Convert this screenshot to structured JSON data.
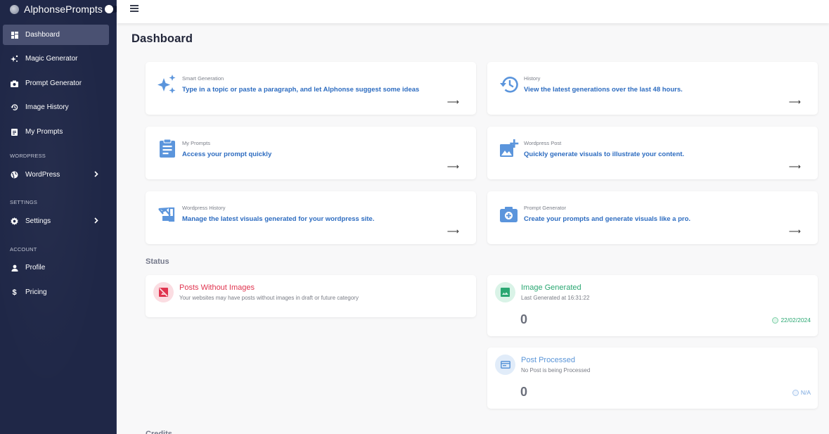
{
  "brand": {
    "name": "AlphonsePrompts"
  },
  "sidebar": {
    "items": [
      {
        "label": "Dashboard",
        "icon": "dashboard-icon",
        "active": true
      },
      {
        "label": "Magic Generator",
        "icon": "sparkles-icon"
      },
      {
        "label": "Prompt Generator",
        "icon": "camera-icon"
      },
      {
        "label": "Image History",
        "icon": "history-icon"
      },
      {
        "label": "My Prompts",
        "icon": "clipboard-icon"
      }
    ],
    "sections": [
      {
        "label": "WORDPRESS",
        "items": [
          {
            "label": "WordPress",
            "icon": "globe-icon",
            "has_submenu": true
          }
        ]
      },
      {
        "label": "SETTINGS",
        "items": [
          {
            "label": "Settings",
            "icon": "gear-icon",
            "has_submenu": true
          }
        ]
      },
      {
        "label": "ACCOUNT",
        "items": [
          {
            "label": "Profile",
            "icon": "user-icon"
          },
          {
            "label": "Pricing",
            "icon": "dollar-icon"
          }
        ]
      }
    ]
  },
  "page": {
    "title": "Dashboard"
  },
  "features": [
    {
      "label": "Smart Generation",
      "description": "Type in a topic or paste a paragraph, and let Alphonse suggest some ideas",
      "icon": "sparkles-icon",
      "arrow": "⟶"
    },
    {
      "label": "History",
      "description": "View the latest generations over the last 48 hours.",
      "icon": "history-icon",
      "arrow": "⟶"
    },
    {
      "label": "My Prompts",
      "description": "Access your prompt quickly",
      "icon": "clipboard-icon",
      "arrow": "⟶"
    },
    {
      "label": "Wordpress Post",
      "description": "Quickly generate visuals to illustrate your content.",
      "icon": "add-image-icon",
      "arrow": "⟶"
    },
    {
      "label": "Wordpress History",
      "description": "Manage the latest visuals generated for your wordpress site.",
      "icon": "image-history-icon",
      "arrow": "⟶"
    },
    {
      "label": "Prompt Generator",
      "description": "Create your prompts and generate visuals like a pro.",
      "icon": "camera-plus-icon",
      "arrow": "⟶"
    }
  ],
  "status": {
    "title": "Status",
    "posts_without_images": {
      "title": "Posts Without Images",
      "subtitle": "Your websites may have posts without images in draft or future category",
      "color": "#e0344f",
      "bg": "#fbdde2"
    },
    "image_generated": {
      "title": "Image Generated",
      "subtitle": "Last Generated at 16:31:22",
      "count": "0",
      "date": "22/02/2024",
      "color": "#2aa772",
      "bg": "#d9f3e7"
    },
    "post_processed": {
      "title": "Post Processed",
      "subtitle": "No Post is being Processed",
      "count": "0",
      "date": "N/A",
      "color": "#5a95d8",
      "bg": "#e1ecf9"
    }
  },
  "next_section": {
    "title": "Credits"
  }
}
